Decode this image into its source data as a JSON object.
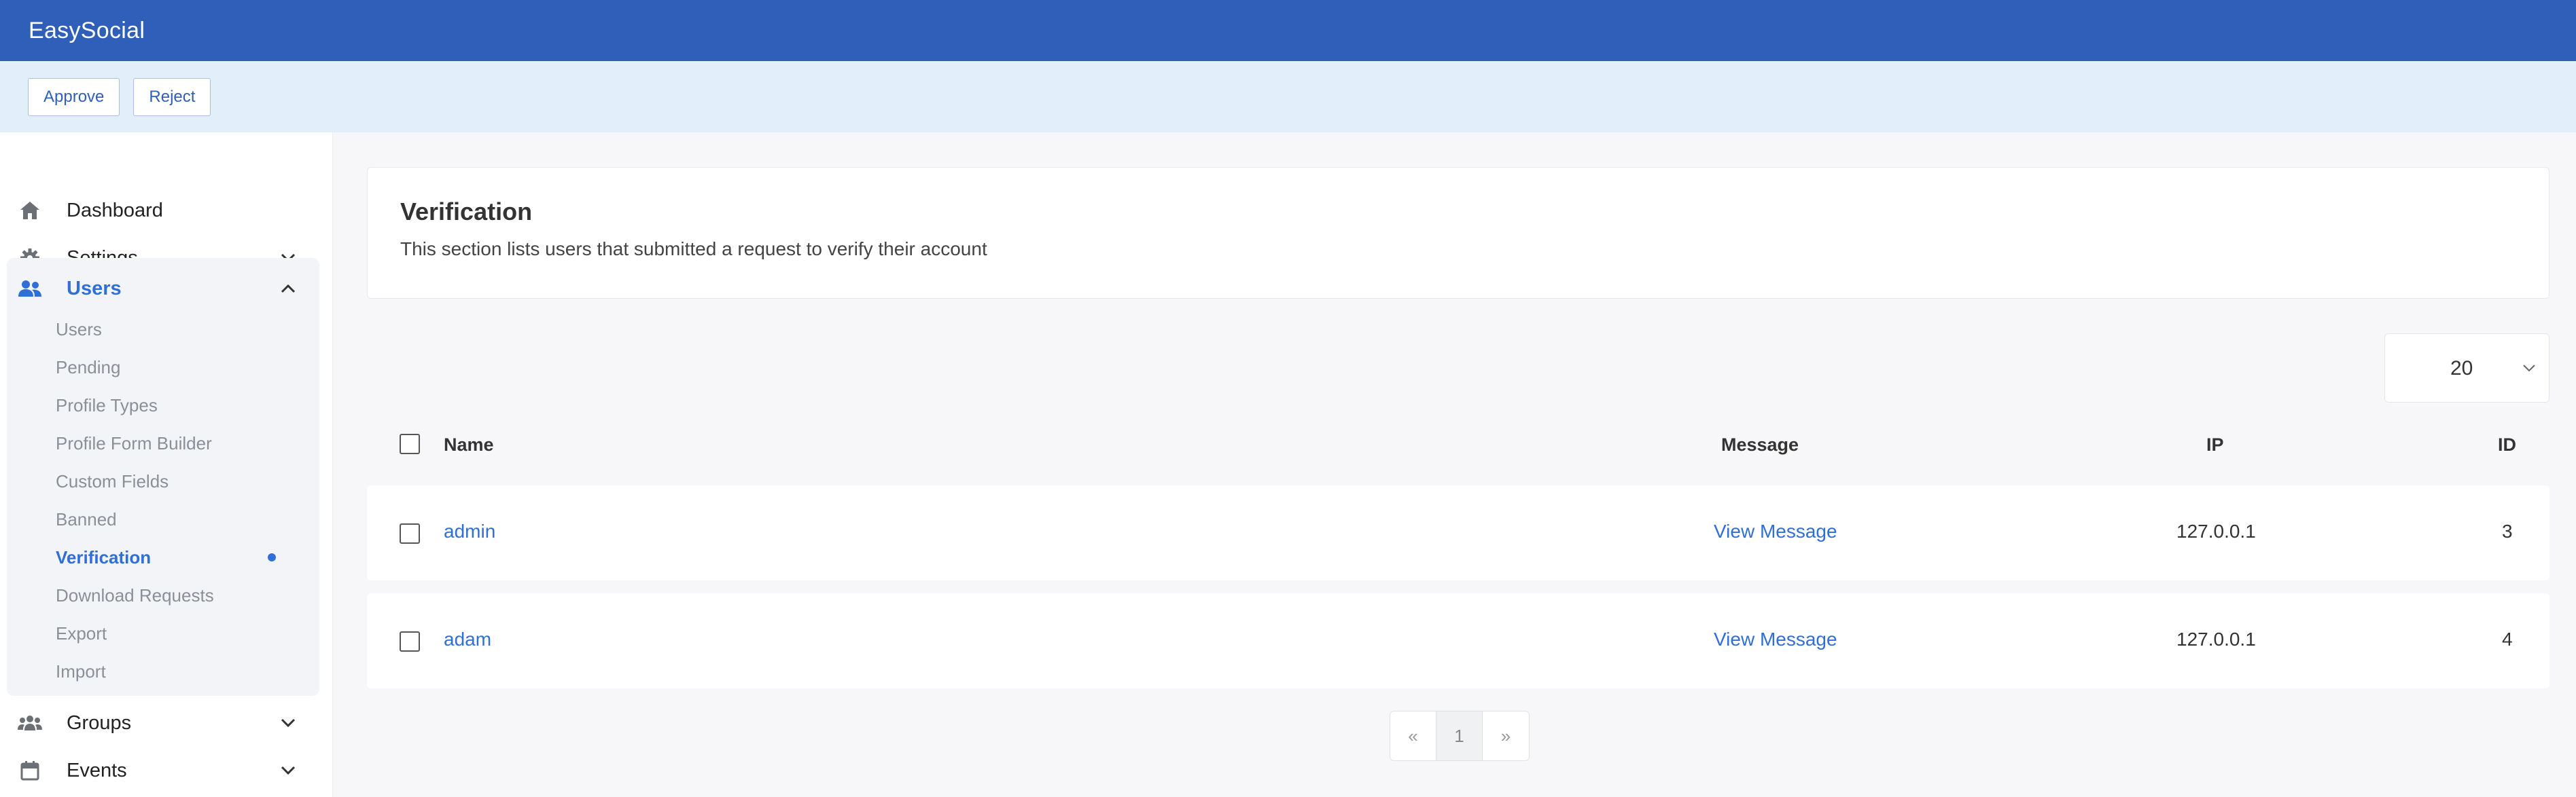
{
  "app": {
    "title": "EasySocial"
  },
  "toolbar": {
    "approve_label": "Approve",
    "reject_label": "Reject"
  },
  "sidebar": {
    "dashboard": "Dashboard",
    "settings": "Settings",
    "users": "Users",
    "users_items": [
      "Users",
      "Pending",
      "Profile Types",
      "Profile Form Builder",
      "Custom Fields",
      "Banned",
      "Verification",
      "Download Requests",
      "Export",
      "Import"
    ],
    "active_item": "Verification",
    "groups": "Groups",
    "events": "Events"
  },
  "header": {
    "title": "Verification",
    "description": "This section lists users that submitted a request to verify their account"
  },
  "limit": {
    "value": "20"
  },
  "table": {
    "columns": {
      "name": "Name",
      "message": "Message",
      "ip": "IP",
      "id": "ID"
    },
    "rows": [
      {
        "name": "admin",
        "message": "View Message",
        "ip": "127.0.0.1",
        "id": "3"
      },
      {
        "name": "adam",
        "message": "View Message",
        "ip": "127.0.0.1",
        "id": "4"
      }
    ]
  },
  "pagination": {
    "prev": "«",
    "current": "1",
    "next": "»"
  },
  "colors": {
    "brand": "#2f5fb8",
    "accent": "#2f6fd6",
    "toolbar_bg": "#e3eefb"
  },
  "icons": {
    "dashboard": "home-icon",
    "settings": "gear-icon",
    "users": "users-icon",
    "groups": "groups-icon",
    "events": "calendar-icon"
  }
}
